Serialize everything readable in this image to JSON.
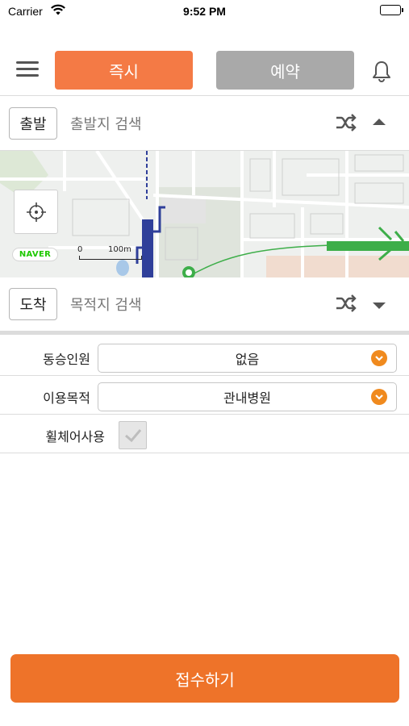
{
  "status_bar": {
    "carrier": "Carrier",
    "time": "9:52 PM"
  },
  "top_nav": {
    "menu_icon": "hamburger-icon",
    "tab_now_label": "즉시",
    "tab_reserve_label": "예약",
    "bell_icon": "bell-icon"
  },
  "departure": {
    "tag": "출발",
    "placeholder": "출발지 검색",
    "shuffle_icon": "shuffle-icon",
    "arrow_icon": "caret-up-icon"
  },
  "map": {
    "logo_text": "NAVER",
    "scale_zero": "0",
    "scale_distance": "100m",
    "locate_icon": "crosshair-icon"
  },
  "arrival": {
    "tag": "도착",
    "placeholder": "목적지 검색",
    "shuffle_icon": "shuffle-icon",
    "arrow_icon": "caret-down-icon"
  },
  "form": {
    "companions_label": "동승인원",
    "companions_value": "없음",
    "purpose_label": "이용목적",
    "purpose_value": "관내병원",
    "wheelchair_label": "휠체어사용",
    "wheelchair_checked": true
  },
  "submit_label": "접수하기",
  "colors": {
    "accent": "#F47A45",
    "inactive_tab": "#A9A9A9",
    "submit": "#EE7329",
    "chevron": "#F08A1E",
    "naver_green": "#1EC800"
  }
}
